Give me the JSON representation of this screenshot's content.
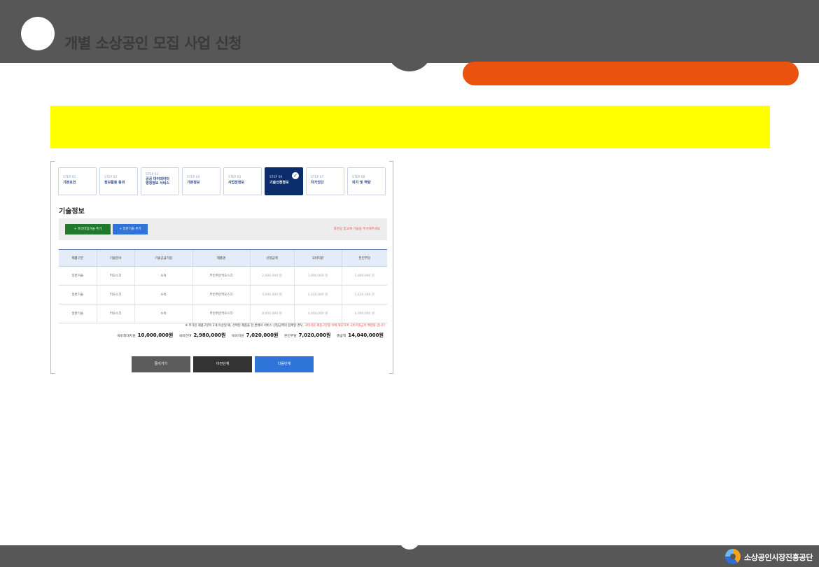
{
  "header": {
    "title": "개별 소상공인 모집 사업 신청"
  },
  "steps": [
    {
      "num": "STEP 01",
      "label": "기본요건"
    },
    {
      "num": "STEP 02",
      "label": "정보활용 동의"
    },
    {
      "num": "STEP 03",
      "label": "공공 마이데이터",
      "label2": "행정정보 서비스"
    },
    {
      "num": "STEP 04",
      "label": "기본정보"
    },
    {
      "num": "STEP 05",
      "label": "사업장정보"
    },
    {
      "num": "STEP 06",
      "label": "기술신청정보"
    },
    {
      "num": "STEP 07",
      "label": "자가진단"
    },
    {
      "num": "STEP 08",
      "label": "의지 및 역량"
    }
  ],
  "section": {
    "title": "기술정보"
  },
  "toolbar": {
    "add_premium": "+ 프리미엄기술 추가",
    "add_general": "+ 일반기술 추가",
    "note": "화면상 참고해 기술을 추가해주세요"
  },
  "table": {
    "headers": [
      "제품구분",
      "기술분야",
      "기술공급기업",
      "제품명",
      "신청금액",
      "국비지원",
      "본인부담"
    ],
    "rows": [
      [
        "일반기술",
        "키오스크",
        "소속",
        "무인주문키오스크",
        "2,000,000 원",
        "1,000,000 원",
        "1,000,000 원"
      ],
      [
        "일반기술",
        "키오스크",
        "소속",
        "무인주문키오스크",
        "4,040,000 원",
        "2,020,000 원",
        "2,020,000 원"
      ],
      [
        "일반기술",
        "키오스크",
        "소속",
        "무인주문키오스크",
        "8,000,000 원",
        "4,000,000 원",
        "4,000,000 원"
      ]
    ]
  },
  "footnote": {
    "text": "※ 추가된 제품구분이 2개 이상일 때, 선택된 제품을 한 번에서 서비스 신청금액의 합계일 경우,",
    "highlight": "국비지원 제품구분별 이에 해당하여 국비지원금이 배정될 겁니다"
  },
  "totals": [
    {
      "label": "국비최대지원",
      "value": "10,000,000원"
    },
    {
      "label": "국비잔여",
      "value": "2,980,000원"
    },
    {
      "label": "국비지원",
      "value": "7,020,000원"
    },
    {
      "label": "본인부담",
      "value": "7,020,000원"
    },
    {
      "label": "총금액",
      "value": "14,040,000원"
    }
  ],
  "actions": {
    "back": "돌아가기",
    "prev": "이전단계",
    "next": "다음단계"
  },
  "footer": {
    "org": "소상공인시장진흥공단"
  }
}
